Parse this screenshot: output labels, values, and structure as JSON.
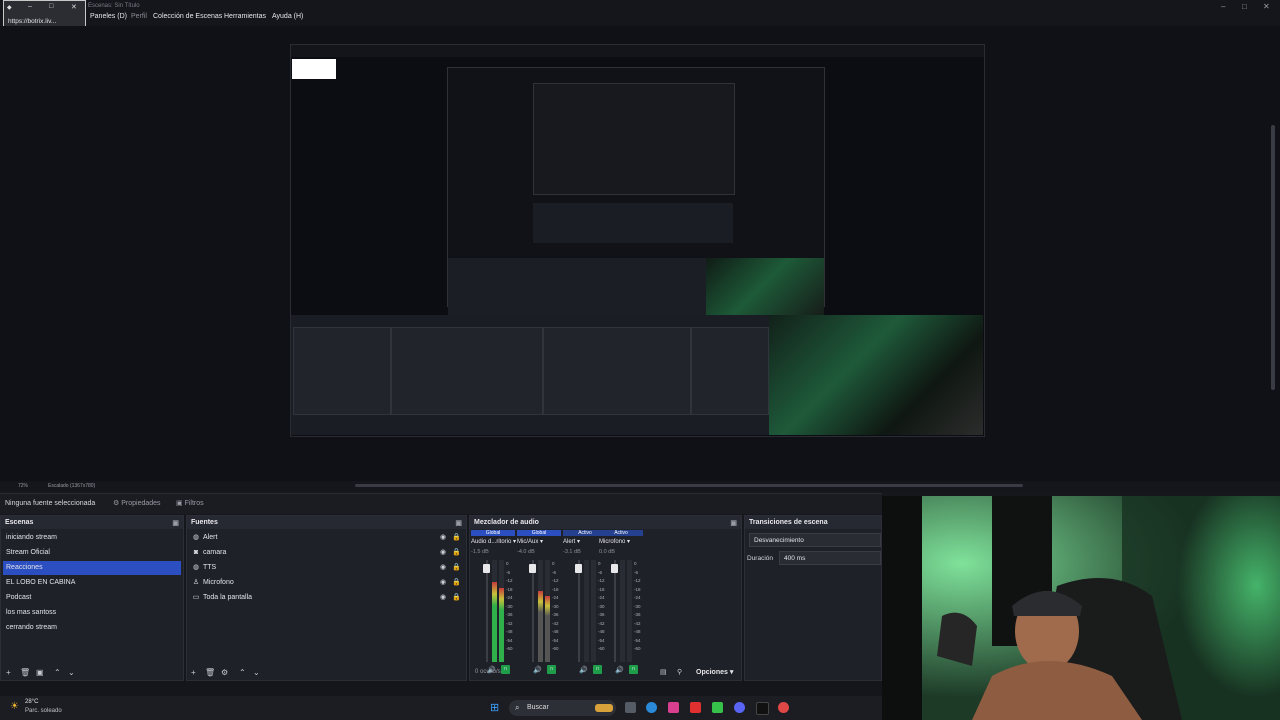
{
  "window": {
    "title": "Escenas: Sin Título"
  },
  "menu": {
    "items": [
      "Paneles (D)",
      "Perfil",
      "Colección de Escenas",
      "Herramientas",
      "Ayuda (H)"
    ]
  },
  "popup": {
    "url": "https://botrix.liv..."
  },
  "preview": {
    "zoom": "72%",
    "scale_label": "Escalado (1367x780)"
  },
  "context_bar": {
    "no_source": "Ninguna fuente seleccionada",
    "properties": "Propiedades",
    "filters": "Filtros"
  },
  "scenes": {
    "title": "Escenas",
    "items": [
      "iniciando stream",
      "Stream Oficial",
      "Reacciones",
      "EL LOBO EN CABINA",
      "Podcast",
      "los mas santoss",
      "cerrando stream"
    ],
    "active_index": 2
  },
  "sources": {
    "title": "Fuentes",
    "items": [
      {
        "label": "Alert",
        "icon": "globe-icon"
      },
      {
        "label": "camara",
        "icon": "camera-icon"
      },
      {
        "label": "TTS",
        "icon": "globe-icon"
      },
      {
        "label": "Microfono",
        "icon": "microphone-icon"
      },
      {
        "label": "Toda la pantalla",
        "icon": "monitor-icon"
      }
    ]
  },
  "mixer": {
    "title": "Mezclador de audio",
    "channels": [
      {
        "top": "Global",
        "name": "Audio d...ritorio",
        "db": "-1.5 dB",
        "level": 0.78,
        "color": "#2fb04a"
      },
      {
        "top": "Global",
        "name": "Mic/Aux",
        "db": "-4.0 dB",
        "level": 0.7,
        "color": "#555"
      },
      {
        "top": "Activo",
        "name": "Alert",
        "db": "-3.1 dB",
        "level": 0.0,
        "color": "#2fb04a"
      },
      {
        "top": "Activo",
        "name": "Microfono",
        "db": "0.0 dB",
        "level": 0.0,
        "color": "#2fb04a"
      }
    ],
    "scale": [
      "0",
      "-6",
      "-12",
      "-18",
      "-24",
      "-30",
      "-36",
      "-42",
      "-48",
      "-54",
      "-60"
    ],
    "hidden": "0 oculto/s",
    "options": "Opciones"
  },
  "transitions": {
    "title": "Transiciones de escena",
    "type": "Desvanecimiento",
    "duration_label": "Duración",
    "duration_value": "400 ms"
  },
  "status": {
    "temp": "28°C",
    "weather": "Parc. soleado"
  },
  "taskbar": {
    "search": "Buscar"
  }
}
